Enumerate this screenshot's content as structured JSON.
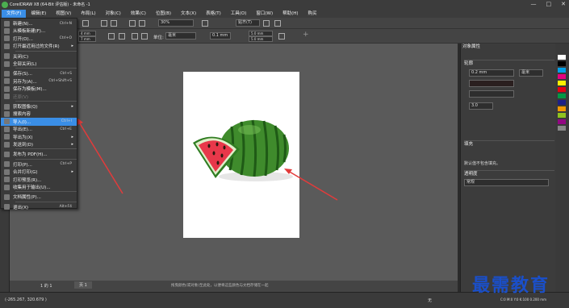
{
  "window": {
    "title": "CorelDRAW X8 (64-Bit 评估版) - 未命名 -1",
    "controls": [
      "—",
      "□",
      "✕"
    ]
  },
  "menubar": [
    "文件(F)",
    "编辑(E)",
    "视图(V)",
    "布局(L)",
    "对象(C)",
    "效果(C)",
    "位图(B)",
    "文本(X)",
    "表格(T)",
    "工具(O)",
    "窗口(W)",
    "帮助(H)",
    "购买"
  ],
  "toolbar2": {
    "zoom": "30%",
    "units_label": "单位:",
    "units": "毫米",
    "nudge": "0.1 mm",
    "dup_x": "5.0 mm",
    "dup_y": "5.0 mm",
    "size_w": "4 mm",
    "size_h": "7 mm",
    "align_label": "贴齐(T)"
  },
  "file_menu": [
    {
      "label": "新建(N)...",
      "shortcut": "Ctrl+N"
    },
    {
      "label": "从模板新建(F)...",
      "shortcut": ""
    },
    {
      "label": "打开(O)...",
      "shortcut": "Ctrl+O"
    },
    {
      "label": "打开最近用过的文件(R)",
      "shortcut": "",
      "submenu": true
    },
    {
      "sep": true
    },
    {
      "label": "关闭(C)",
      "shortcut": ""
    },
    {
      "label": "全部关闭(L)",
      "shortcut": ""
    },
    {
      "sep": true
    },
    {
      "label": "保存(S)...",
      "shortcut": "Ctrl+S"
    },
    {
      "label": "另存为(A)...",
      "shortcut": "Ctrl+Shift+S"
    },
    {
      "label": "保存为模板(M)...",
      "shortcut": ""
    },
    {
      "label": "还原(V)",
      "shortcut": "",
      "disabled": true
    },
    {
      "sep": true
    },
    {
      "label": "获取图像(Q)",
      "shortcut": "",
      "submenu": true
    },
    {
      "label": "搜索内容",
      "shortcut": ""
    },
    {
      "label": "导入(I)...",
      "shortcut": "Ctrl+I",
      "highlight": true
    },
    {
      "label": "导出(E)...",
      "shortcut": "Ctrl+E"
    },
    {
      "label": "导出为(X)",
      "shortcut": "",
      "submenu": true
    },
    {
      "label": "发送到(D)",
      "shortcut": "",
      "submenu": true
    },
    {
      "sep": true
    },
    {
      "label": "发布为 PDF(H)...",
      "shortcut": ""
    },
    {
      "sep": true
    },
    {
      "label": "打印(P)...",
      "shortcut": "Ctrl+P"
    },
    {
      "label": "合并打印(G)",
      "shortcut": "",
      "submenu": true
    },
    {
      "label": "打印预览(R)...",
      "shortcut": ""
    },
    {
      "label": "收集用于输出(U)...",
      "shortcut": ""
    },
    {
      "sep": true
    },
    {
      "label": "文档属性(P)...",
      "shortcut": ""
    },
    {
      "sep": true
    },
    {
      "label": "退出(X)",
      "shortcut": "Alt+F4"
    }
  ],
  "rightpanel": {
    "title": "对象属性",
    "outline_label": "轮廓",
    "outline_width": "0.2 mm",
    "outline_unit": "毫米",
    "corner_value": "3.0",
    "fill_label": "填充",
    "fill_text": "默认值不包含填充。",
    "transparency_label": "透明度",
    "transparency_mode": "常规"
  },
  "pagetabs": {
    "page": "页 1",
    "nav": "1 的 1"
  },
  "statusbar": {
    "coords": "(-265.267, 320.679 )",
    "hint": "拖曳颜色(或对象)至此处，以便将这些颜色与文档存储在一起",
    "fill_status": "无",
    "color_info": "C:0 M:0 Y:0 K:100 0.200 mm"
  },
  "watermark": "最需教育",
  "colors": {
    "accent": "#3a8ee6",
    "watermark": "#1a4fc9",
    "arrow": "#e23b3b"
  }
}
